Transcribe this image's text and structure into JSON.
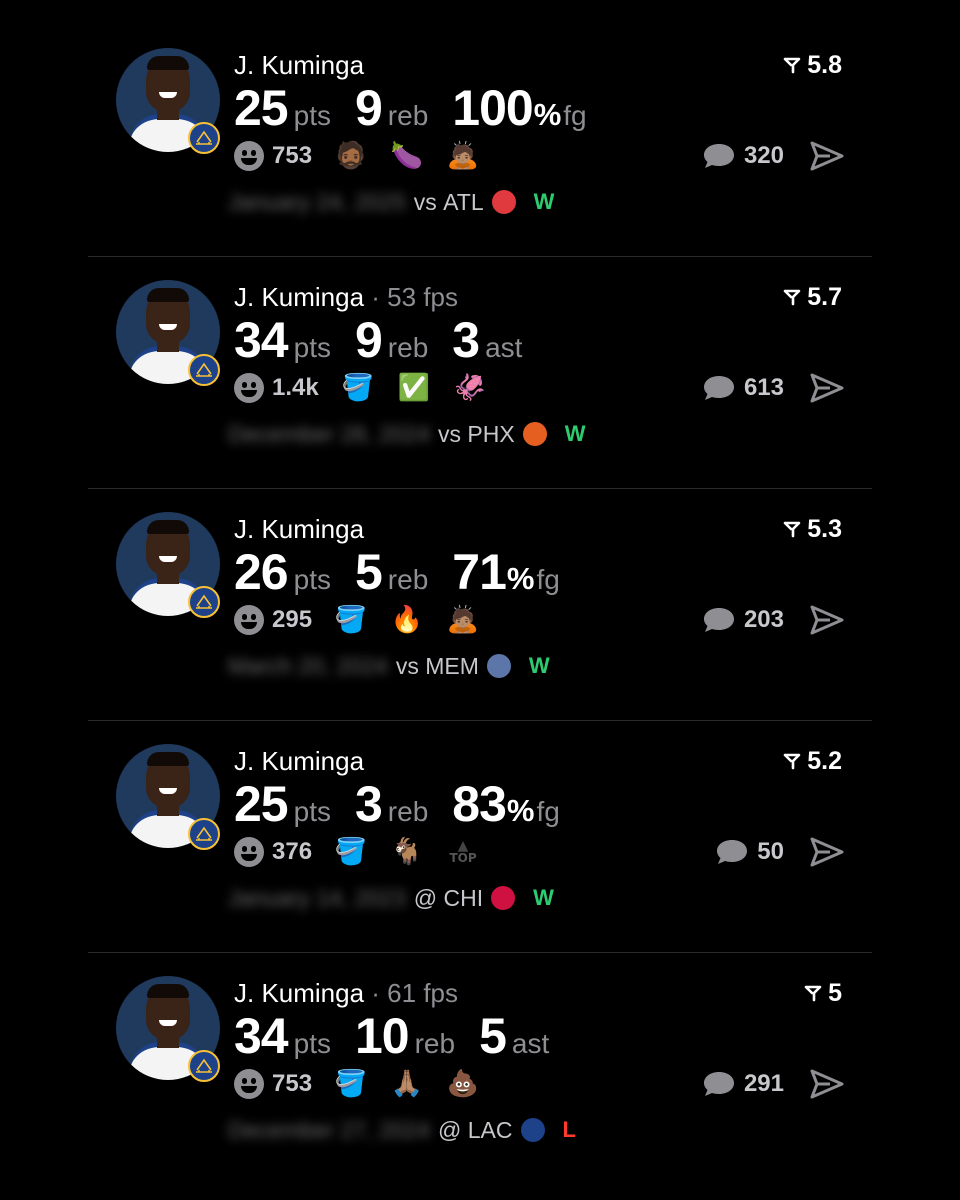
{
  "colors": {
    "background": "#000000",
    "muted": "#8e8e93",
    "win": "#2ecc71",
    "loss": "#ff3b30",
    "warriors_blue": "#1d428a",
    "warriors_gold": "#f8c035"
  },
  "posts": [
    {
      "player": "J. Kuminga",
      "fps": "",
      "rating": "5.8",
      "stats": [
        {
          "value": "25",
          "pct": "",
          "unit": "pts"
        },
        {
          "value": "9",
          "pct": "",
          "unit": "reb"
        },
        {
          "value": "100",
          "pct": "%",
          "unit": "fg"
        }
      ],
      "reaction_count": "753",
      "emojis": [
        "🧔🏾",
        "🍆",
        "🙇🏽"
      ],
      "comments": "320",
      "date": "January 24, 2025",
      "location": "vs",
      "opponent": "ATL",
      "opponent_logo_color": "#e03a3e",
      "result": "W"
    },
    {
      "player": "J. Kuminga",
      "fps": " · 53 fps",
      "rating": "5.7",
      "stats": [
        {
          "value": "34",
          "pct": "",
          "unit": "pts"
        },
        {
          "value": "9",
          "pct": "",
          "unit": "reb"
        },
        {
          "value": "3",
          "pct": "",
          "unit": "ast"
        }
      ],
      "reaction_count": "1.4k",
      "emojis": [
        "🪣",
        "✅",
        "🦑"
      ],
      "comments": "613",
      "date": "December 28, 2024",
      "location": "vs",
      "opponent": "PHX",
      "opponent_logo_color": "#e56020",
      "result": "W"
    },
    {
      "player": "J. Kuminga",
      "fps": "",
      "rating": "5.3",
      "stats": [
        {
          "value": "26",
          "pct": "",
          "unit": "pts"
        },
        {
          "value": "5",
          "pct": "",
          "unit": "reb"
        },
        {
          "value": "71",
          "pct": "%",
          "unit": "fg"
        }
      ],
      "reaction_count": "295",
      "emojis": [
        "🪣",
        "🔥",
        "🙇🏽"
      ],
      "comments": "203",
      "date": "March 20, 2024",
      "location": "vs",
      "opponent": "MEM",
      "opponent_logo_color": "#5d76a9",
      "result": "W"
    },
    {
      "player": "J. Kuminga",
      "fps": "",
      "rating": "5.2",
      "stats": [
        {
          "value": "25",
          "pct": "",
          "unit": "pts"
        },
        {
          "value": "3",
          "pct": "",
          "unit": "reb"
        },
        {
          "value": "83",
          "pct": "%",
          "unit": "fg"
        }
      ],
      "reaction_count": "376",
      "emojis": [
        "🪣",
        "🐐",
        "TOP"
      ],
      "comments": "50",
      "date": "January 14, 2023",
      "location": "@",
      "opponent": "CHI",
      "opponent_logo_color": "#ce1141",
      "result": "W"
    },
    {
      "player": "J. Kuminga",
      "fps": " · 61 fps",
      "rating": "5",
      "stats": [
        {
          "value": "34",
          "pct": "",
          "unit": "pts"
        },
        {
          "value": "10",
          "pct": "",
          "unit": "reb"
        },
        {
          "value": "5",
          "pct": "",
          "unit": "ast"
        }
      ],
      "reaction_count": "753",
      "emojis": [
        "🪣",
        "🙏🏽",
        "💩"
      ],
      "comments": "291",
      "date": "December 27, 2024",
      "location": "@",
      "opponent": "LAC",
      "opponent_logo_color": "#1d428a",
      "result": "L"
    }
  ]
}
